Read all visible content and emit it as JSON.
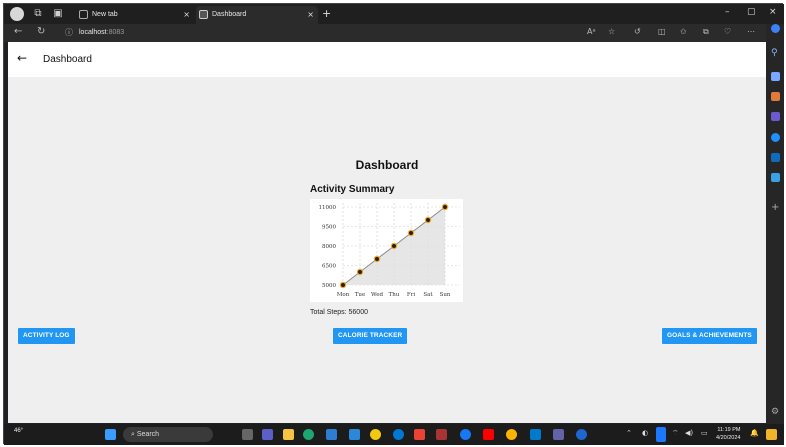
{
  "browser": {
    "tabs": [
      {
        "label": "New tab",
        "close": "×"
      },
      {
        "label": "Dashboard",
        "close": "×"
      }
    ],
    "new_tab": "+",
    "url_host": "localhost",
    "url_port": ":8083",
    "window_controls": [
      "–",
      "▢",
      "×"
    ]
  },
  "app": {
    "back_icon": "←",
    "title": "Dashboard",
    "heading": "Dashboard",
    "summary_title": "Activity Summary",
    "total_steps": "Total Steps: 56000",
    "buttons": {
      "activity_log": "ACTIVITY LOG",
      "calorie_tracker": "CALORIE TRACKER",
      "goals": "GOALS & ACHIEVEMENTS"
    },
    "accent_color": "#2196f3"
  },
  "chart_data": {
    "type": "area",
    "categories": [
      "Mon",
      "Tue",
      "Wed",
      "Thu",
      "Fri",
      "Sat",
      "Sun"
    ],
    "values": [
      5000,
      6000,
      7000,
      8000,
      9000,
      10000,
      11000
    ],
    "yticks": [
      "5000",
      "6500",
      "8000",
      "9500",
      "11000"
    ],
    "ylim": [
      5000,
      11000
    ],
    "grid": true,
    "point_color": "#f5a623",
    "fill_color": "#e0e0e0"
  },
  "taskbar": {
    "weather": "46°",
    "search_label": "Search",
    "time": "11:19 PM",
    "date": "4/20/2024"
  }
}
